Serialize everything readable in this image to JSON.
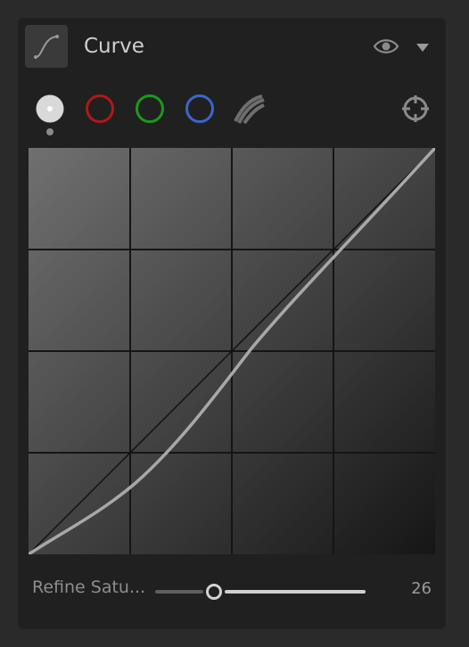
{
  "panel": {
    "title": "Curve",
    "icons": {
      "tool": "curve-tool-icon",
      "visibility": "eye-icon",
      "collapse": "triangle-down-icon",
      "picker": "crosshair-target-icon"
    }
  },
  "channels": [
    {
      "name": "luminosity",
      "color": "#d9d9d9",
      "selected": true
    },
    {
      "name": "red",
      "color": "#b01818",
      "selected": false
    },
    {
      "name": "green",
      "color": "#1a9a1a",
      "selected": false
    },
    {
      "name": "blue",
      "color": "#3a66cc",
      "selected": false
    },
    {
      "name": "luminosity-curve",
      "color": "#6e6e6e",
      "selected": false
    }
  ],
  "curve": {
    "grid_divisions": 4,
    "curve_color": "#a8a8a8",
    "diagonal_color": "#111111",
    "grid_color": "#151515",
    "background_light": "#707070",
    "background_dark": "#161616"
  },
  "slider": {
    "label": "Refine Satu...",
    "value_text": "26",
    "position_fraction": 0.28
  }
}
